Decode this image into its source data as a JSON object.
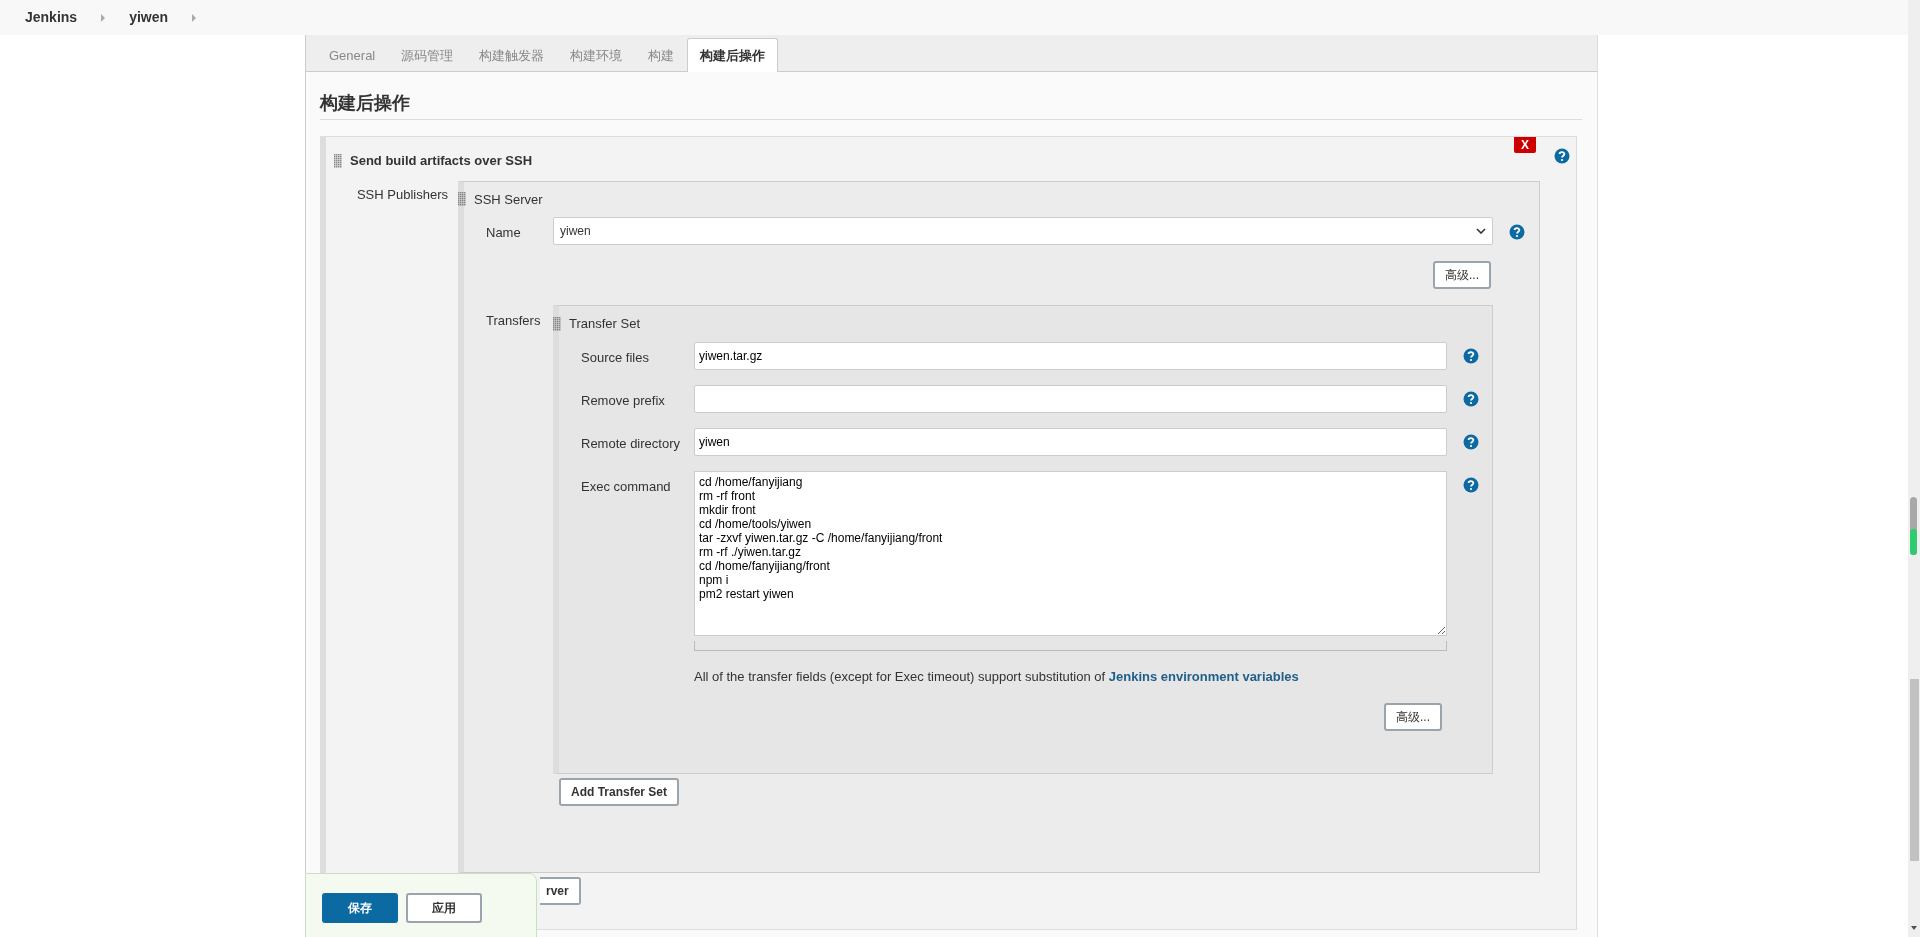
{
  "breadcrumbs": [
    {
      "label": "Jenkins"
    },
    {
      "label": "yiwen"
    }
  ],
  "tabs": [
    {
      "label": "General",
      "selected": false
    },
    {
      "label": "源码管理",
      "selected": false
    },
    {
      "label": "构建触发器",
      "selected": false
    },
    {
      "label": "构建环境",
      "selected": false
    },
    {
      "label": "构建",
      "selected": false
    },
    {
      "label": "构建后操作",
      "selected": true
    }
  ],
  "section_title": "构建后操作",
  "publisher": {
    "title": "Send build artifacts over SSH",
    "delete_label": "X",
    "ssh_publishers_label": "SSH Publishers",
    "server": {
      "title": "SSH Server",
      "name_label": "Name",
      "name_value": "yiwen",
      "advanced_button": "高级...",
      "transfers_label": "Transfers",
      "transfer_set": {
        "title": "Transfer Set",
        "fields": [
          {
            "kind": "input",
            "label": "Source files",
            "value": "yiwen.tar.gz"
          },
          {
            "kind": "input",
            "label": "Remove prefix"
          },
          {
            "kind": "input",
            "label": "Remote directory",
            "value": "yiwen"
          },
          {
            "kind": "textarea",
            "label": "Exec command",
            "value": "cd /home/fanyijiang\nrm -rf front\nmkdir front\ncd /home/tools/yiwen\ntar -zxvf yiwen.tar.gz -C /home/fanyijiang/front\nrm -rf ./yiwen.tar.gz\ncd /home/fanyijiang/front\nnpm i\npm2 restart yiwen"
          }
        ],
        "note": "All of the transfer fields (except for Exec timeout) support substitution of ",
        "note_link": "Jenkins environment variables",
        "advanced_button": "高级..."
      },
      "add_transfer_button": "Add Transfer Set"
    },
    "add_server_button": "rver"
  },
  "save_bar": {
    "save": "保存",
    "apply": "应用"
  }
}
